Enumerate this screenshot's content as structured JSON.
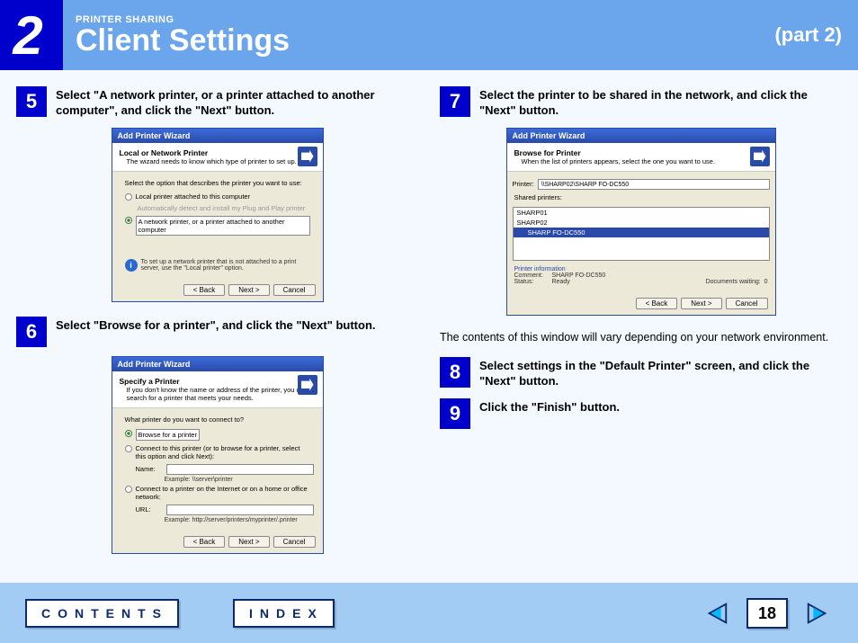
{
  "header": {
    "chapter_number": "2",
    "overline": "PRINTER SHARING",
    "title": "Client Settings",
    "part": "(part 2)"
  },
  "left_column": {
    "step5": {
      "num": "5",
      "text": "Select \"A network printer, or a printer attached to another computer\", and click the \"Next\" button."
    },
    "step6": {
      "num": "6",
      "text": "Select \"Browse for a printer\", and click the \"Next\" button."
    }
  },
  "right_column": {
    "step7": {
      "num": "7",
      "text": "Select the printer to be shared in the network, and click the \"Next\" button."
    },
    "caption7": "The contents of this window will vary depending on your network environment.",
    "step8": {
      "num": "8",
      "text": "Select settings in the \"Default Printer\" screen, and click the \"Next\" button."
    },
    "step9": {
      "num": "9",
      "text": "Click the \"Finish\" button."
    }
  },
  "dialog5": {
    "title": "Add Printer Wizard",
    "head_title": "Local or Network Printer",
    "head_sub": "The wizard needs to know which type of printer to set up.",
    "label": "Select the option that describes the printer you want to use:",
    "opt_local": "Local printer attached to this computer",
    "opt_auto": "Automatically detect and install my Plug and Play printer",
    "opt_network": "A network printer, or a printer attached to another computer",
    "info": "To set up a network printer that is not attached to a print server, use the \"Local printer\" option.",
    "btn_back": "< Back",
    "btn_next": "Next >",
    "btn_cancel": "Cancel"
  },
  "dialog6": {
    "title": "Add Printer Wizard",
    "head_title": "Specify a Printer",
    "head_sub": "If you don't know the name or address of the printer, you can search for a printer that meets your needs.",
    "label": "What printer do you want to connect to?",
    "opt_browse": "Browse for a printer",
    "opt_connect": "Connect to this printer (or to browse for a printer, select this option and click Next):",
    "name_label": "Name:",
    "name_example": "Example: \\\\server\\printer",
    "opt_url": "Connect to a printer on the Internet or on a home or office network:",
    "url_label": "URL:",
    "url_example": "Example: http://server/printers/myprinter/.printer",
    "btn_back": "< Back",
    "btn_next": "Next >",
    "btn_cancel": "Cancel"
  },
  "dialog7": {
    "title": "Add Printer Wizard",
    "head_title": "Browse for Printer",
    "head_sub": "When the list of printers appears, select the one you want to use.",
    "printer_label": "Printer:",
    "printer_value": "\\\\SHARP02\\SHARP FO-DC550",
    "shared_label": "Shared printers:",
    "items": [
      "SHARP01",
      "SHARP02",
      "SHARP FO-DC550"
    ],
    "info_label": "Printer information",
    "comment_k": "Comment:",
    "comment_v": "SHARP FO-DC550",
    "status_k": "Status:",
    "status_v": "Ready",
    "docs_k": "Documents waiting:",
    "docs_v": "0",
    "btn_back": "< Back",
    "btn_next": "Next >",
    "btn_cancel": "Cancel"
  },
  "footer": {
    "contents": "CONTENTS",
    "index": "INDEX",
    "page": "18"
  }
}
